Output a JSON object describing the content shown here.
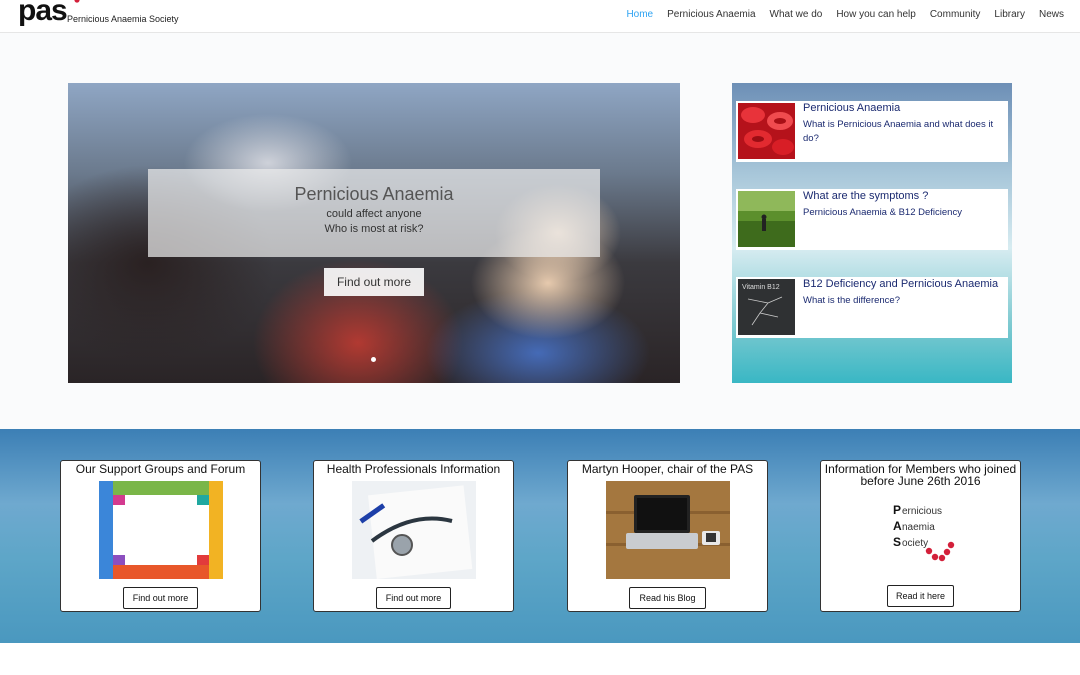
{
  "header": {
    "logo_text": "pas",
    "logo_subtitle": "Pernicious Anaemia Society",
    "nav": [
      {
        "label": "Home",
        "active": true
      },
      {
        "label": "Pernicious Anaemia"
      },
      {
        "label": "What we do"
      },
      {
        "label": "How you can help"
      },
      {
        "label": "Community"
      },
      {
        "label": "Library"
      },
      {
        "label": "News"
      }
    ]
  },
  "hero": {
    "title": "Pernicious Anaemia",
    "line1": "could affect anyone",
    "line2": "Who is most at risk?",
    "button": "Find out more"
  },
  "side_links": [
    {
      "title": "Pernicious Anaemia",
      "subtitle": "What is Pernicious Anaemia and what does it do?",
      "thumb": "red-blood-cells-image"
    },
    {
      "title": "What are the symptoms ?",
      "subtitle": "Pernicious Anaemia & B12 Deficiency",
      "thumb": "person-in-field-image"
    },
    {
      "title": "B12 Deficiency and Pernicious Anaemia",
      "subtitle": "What is the difference?",
      "thumb": "vitamin-b12-chalkboard-image"
    }
  ],
  "cards": [
    {
      "title": "Our Support Groups and Forum",
      "button": "Find out more"
    },
    {
      "title": "Health Professionals Information",
      "button": "Find out more"
    },
    {
      "title": "Martyn Hooper, chair of the PAS",
      "button": "Read his Blog"
    },
    {
      "title": "Information for Members who joined before June 26th 2016",
      "button": "Read it here"
    }
  ],
  "pas_logo_card": {
    "line1_initial": "P",
    "line1_rest": "ernicious",
    "line2_initial": "A",
    "line2_rest": "naemia",
    "line3_initial": "S",
    "line3_rest": "ociety"
  },
  "side_thumb_text": "Vitamin B12",
  "colors": {
    "nav_active": "#2ea3f2",
    "link_text": "#1b2a70",
    "brand_red": "#d3203a"
  }
}
